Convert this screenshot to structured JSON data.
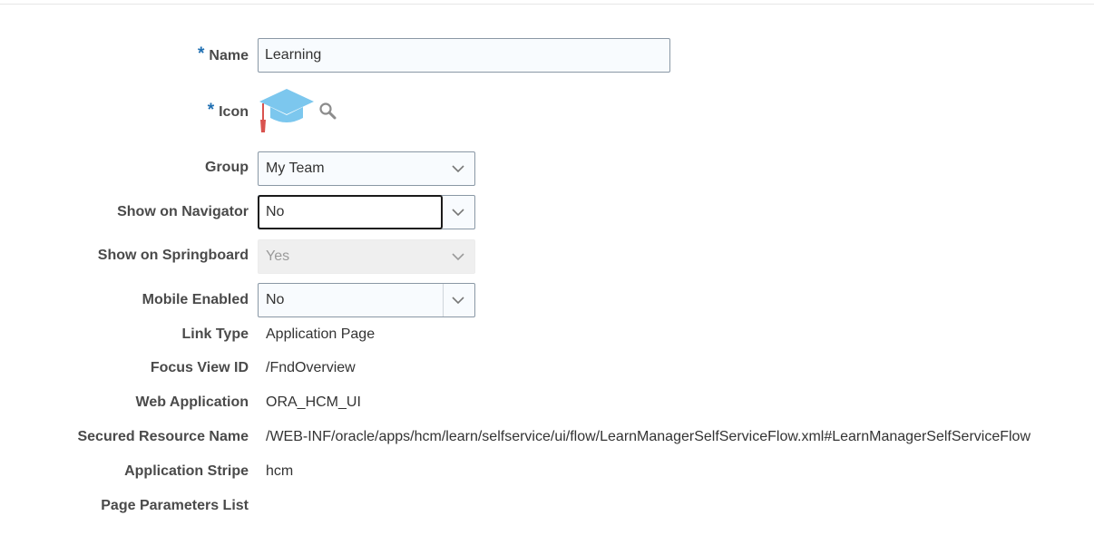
{
  "form": {
    "name": {
      "label": "Name",
      "required_mark": "*",
      "value": "Learning"
    },
    "icon": {
      "label": "Icon",
      "required_mark": "*",
      "icon_name": "graduation-cap-icon",
      "search_icon": "search-icon"
    },
    "group": {
      "label": "Group",
      "value": "My Team"
    },
    "show_on_navigator": {
      "label": "Show on Navigator",
      "value": "No"
    },
    "show_on_springboard": {
      "label": "Show on Springboard",
      "value": "Yes"
    },
    "mobile_enabled": {
      "label": "Mobile Enabled",
      "value": "No"
    },
    "link_type": {
      "label": "Link Type",
      "value": "Application Page"
    },
    "focus_view_id": {
      "label": "Focus View ID",
      "value": "/FndOverview"
    },
    "web_application": {
      "label": "Web Application",
      "value": "ORA_HCM_UI"
    },
    "secured_resource_name": {
      "label": "Secured Resource Name",
      "value": "/WEB-INF/oracle/apps/hcm/learn/selfservice/ui/flow/LearnManagerSelfServiceFlow.xml#LearnManagerSelfServiceFlow"
    },
    "application_stripe": {
      "label": "Application Stripe",
      "value": "hcm"
    },
    "page_parameters_list": {
      "label": "Page Parameters List"
    }
  },
  "colors": {
    "required": "#1f6fb2",
    "cap_blue": "#7cc7ee",
    "tassel_red": "#d9534f",
    "input_border": "#8a98a5",
    "disabled_bg": "#efefef"
  }
}
